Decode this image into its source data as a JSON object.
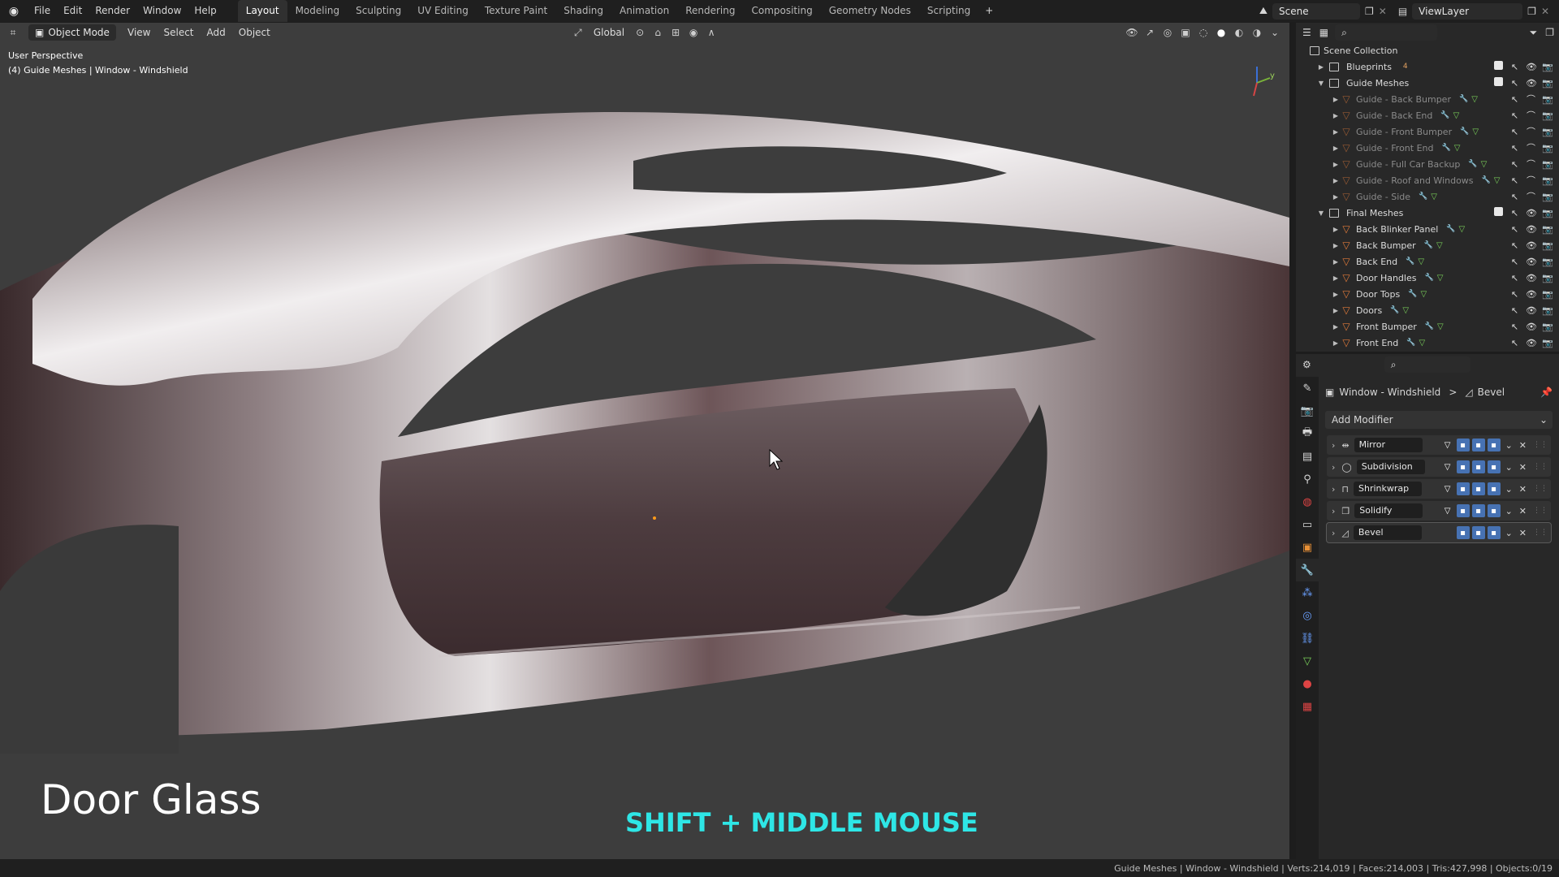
{
  "topbar": {
    "menus": [
      "File",
      "Edit",
      "Render",
      "Window",
      "Help"
    ],
    "workspaces": [
      "Layout",
      "Modeling",
      "Sculpting",
      "UV Editing",
      "Texture Paint",
      "Shading",
      "Animation",
      "Rendering",
      "Compositing",
      "Geometry Nodes",
      "Scripting"
    ],
    "active_workspace": "Layout",
    "add_tab": "+",
    "scene": "Scene",
    "view_layer": "ViewLayer"
  },
  "viewport_header": {
    "mode": "Object Mode",
    "menus": [
      "View",
      "Select",
      "Add",
      "Object"
    ],
    "orientation": "Global"
  },
  "viewport": {
    "perspective_label": "User Perspective",
    "context_label": "(4) Guide Meshes | Window - Windshield",
    "axis_labels": {
      "x": "x",
      "y": "y",
      "z": "z"
    }
  },
  "overlay": {
    "title": "Door Glass",
    "hint": "SHIFT + MIDDLE MOUSE",
    "hint_color": "#2ee6e6"
  },
  "outliner": {
    "root": "Scene Collection",
    "items": [
      {
        "label": "Blueprints",
        "type": "collection",
        "expanded": false,
        "indent": 0,
        "dim": false,
        "badge": "4"
      },
      {
        "label": "Guide Meshes",
        "type": "collection",
        "expanded": true,
        "indent": 0,
        "dim": false
      },
      {
        "label": "Guide - Back Bumper",
        "type": "object",
        "indent": 1,
        "dim": true
      },
      {
        "label": "Guide - Back End",
        "type": "object",
        "indent": 1,
        "dim": true
      },
      {
        "label": "Guide - Front Bumper",
        "type": "object",
        "indent": 1,
        "dim": true
      },
      {
        "label": "Guide - Front End",
        "type": "object",
        "indent": 1,
        "dim": true
      },
      {
        "label": "Guide - Full Car Backup",
        "type": "object",
        "indent": 1,
        "dim": true
      },
      {
        "label": "Guide - Roof and Windows",
        "type": "object",
        "indent": 1,
        "dim": true
      },
      {
        "label": "Guide - Side",
        "type": "object",
        "indent": 1,
        "dim": true
      },
      {
        "label": "Final Meshes",
        "type": "collection",
        "expanded": true,
        "indent": 0,
        "dim": false
      },
      {
        "label": "Back Blinker Panel",
        "type": "object",
        "indent": 1,
        "dim": false
      },
      {
        "label": "Back Bumper",
        "type": "object",
        "indent": 1,
        "dim": false
      },
      {
        "label": "Back End",
        "type": "object",
        "indent": 1,
        "dim": false
      },
      {
        "label": "Door Handles",
        "type": "object",
        "indent": 1,
        "dim": false
      },
      {
        "label": "Door Tops",
        "type": "object",
        "indent": 1,
        "dim": false
      },
      {
        "label": "Doors",
        "type": "object",
        "indent": 1,
        "dim": false
      },
      {
        "label": "Front Bumper",
        "type": "object",
        "indent": 1,
        "dim": false
      },
      {
        "label": "Front End",
        "type": "object",
        "indent": 1,
        "dim": false
      }
    ]
  },
  "properties": {
    "breadcrumb_object": "Window - Windshield",
    "breadcrumb_sep": ">",
    "breadcrumb_modifier": "Bevel",
    "add_modifier": "Add Modifier",
    "modifiers": [
      {
        "name": "Mirror",
        "icon": "mirror-icon",
        "active": false
      },
      {
        "name": "Subdivision",
        "icon": "subdivision-icon",
        "active": false
      },
      {
        "name": "Shrinkwrap",
        "icon": "shrinkwrap-icon",
        "active": false
      },
      {
        "name": "Solidify",
        "icon": "solidify-icon",
        "active": false
      },
      {
        "name": "Bevel",
        "icon": "bevel-icon",
        "active": true
      }
    ]
  },
  "statusbar": {
    "text": "Guide Meshes | Window - Windshield | Verts:214,019 | Faces:214,003 | Tris:427,998 | Objects:0/19"
  }
}
